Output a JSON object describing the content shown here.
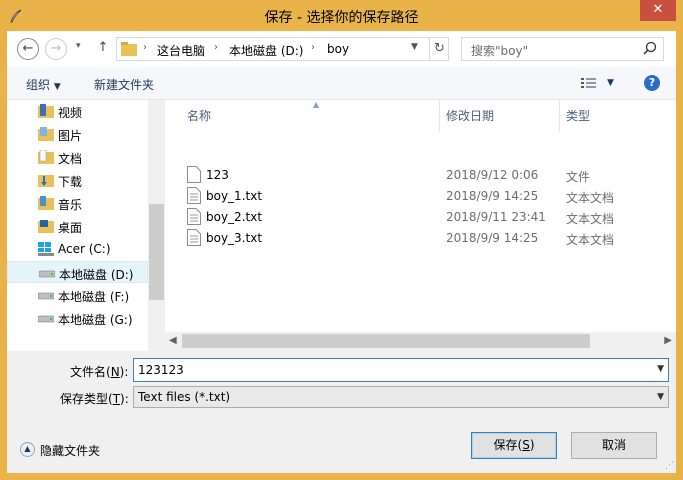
{
  "window": {
    "title": "保存 - 选择你的保存路径",
    "close_glyph": "✕"
  },
  "address": {
    "crumbs": [
      "这台电脑",
      "本地磁盘 (D:)",
      "boy"
    ],
    "separator": "›",
    "refresh_glyph": "↻"
  },
  "nav_buttons": {
    "back": "←",
    "forward": "→",
    "recent": "▾",
    "up": "↑"
  },
  "search": {
    "placeholder": "搜索\"boy\""
  },
  "toolbar": {
    "organize": "组织",
    "new_folder": "新建文件夹",
    "help": "?"
  },
  "nav_pane": {
    "items": [
      {
        "label": "视频",
        "icon": "video-folder-icon"
      },
      {
        "label": "图片",
        "icon": "pictures-folder-icon"
      },
      {
        "label": "文档",
        "icon": "documents-folder-icon"
      },
      {
        "label": "下载",
        "icon": "downloads-folder-icon"
      },
      {
        "label": "音乐",
        "icon": "music-folder-icon"
      },
      {
        "label": "桌面",
        "icon": "desktop-folder-icon"
      },
      {
        "label": "Acer (C:)",
        "icon": "windows-drive-icon"
      },
      {
        "label": "本地磁盘 (D:)",
        "icon": "drive-icon",
        "selected": true
      },
      {
        "label": "本地磁盘 (F:)",
        "icon": "drive-icon"
      },
      {
        "label": "本地磁盘 (G:)",
        "icon": "drive-icon"
      }
    ]
  },
  "file_list": {
    "columns": {
      "name": "名称",
      "date": "修改日期",
      "type": "类型"
    },
    "rows": [
      {
        "name": "123",
        "date": "2018/9/12 0:06",
        "type": "文件"
      },
      {
        "name": "boy_1.txt",
        "date": "2018/9/9 14:25",
        "type": "文本文档"
      },
      {
        "name": "boy_2.txt",
        "date": "2018/9/11 23:41",
        "type": "文本文档"
      },
      {
        "name": "boy_3.txt",
        "date": "2018/9/9 14:25",
        "type": "文本文档"
      }
    ]
  },
  "form": {
    "filename_label": "文件名(",
    "filename_key": "N",
    "filename_label_end": "):",
    "filename_value": "123123",
    "filetype_label": "保存类型(",
    "filetype_key": "T",
    "filetype_label_end": "):",
    "filetype_value": "Text files (*.txt)"
  },
  "footer": {
    "hide_folders": "隐藏文件夹",
    "save_label": "保存(",
    "save_key": "S",
    "save_label_end": ")",
    "cancel_label": "取消"
  },
  "colors": {
    "title_bar": "#e9b34a",
    "close_button": "#c7503f",
    "accent_blue": "#3c7fb1",
    "toolbar_text": "#1e395b"
  }
}
